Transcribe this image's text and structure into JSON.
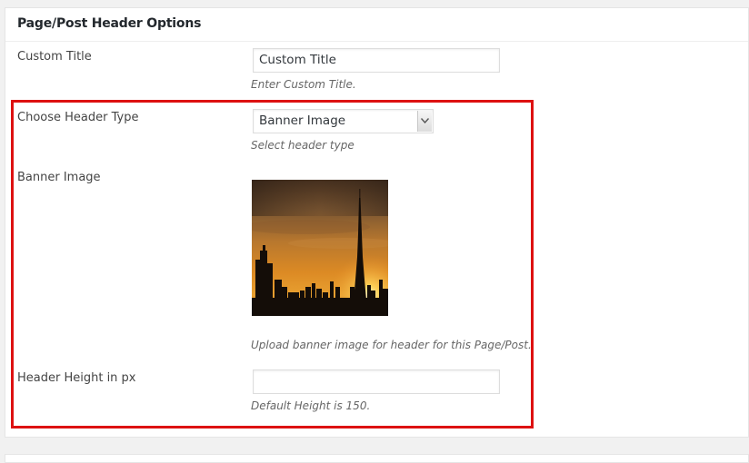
{
  "metabox": {
    "title": "Page/Post Header Options"
  },
  "custom_title": {
    "label": "Custom Title",
    "value": "Custom Title",
    "description": "Enter Custom Title."
  },
  "header_type": {
    "label": "Choose Header Type",
    "selected": "Banner Image",
    "description": "Select header type"
  },
  "banner_image": {
    "label": "Banner Image",
    "description": "Upload banner image for header for this Page/Post."
  },
  "header_height": {
    "label": "Header Height in px",
    "value": "",
    "description": "Default Height is 150."
  },
  "colors": {
    "highlight_border": "#dd1111"
  }
}
